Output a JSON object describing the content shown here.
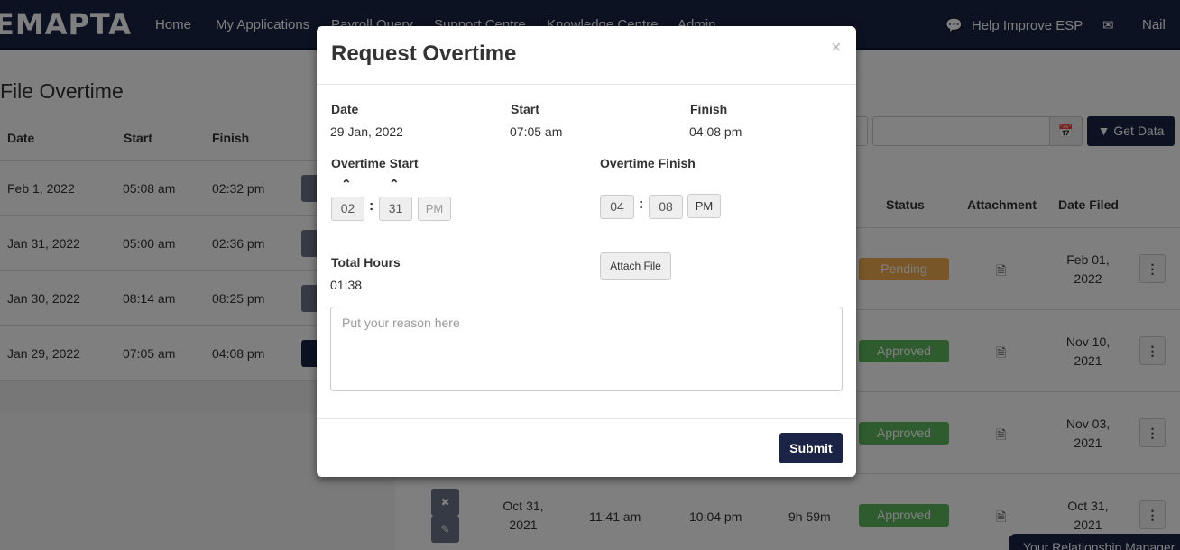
{
  "nav": {
    "logo": "EMAPTA",
    "items": [
      "Home",
      "My Applications",
      "Payroll Query",
      "Support Centre",
      "Knowledge Centre",
      "Admin"
    ],
    "help": "Help Improve ESP",
    "user": "Nail"
  },
  "page": {
    "title": "File Overtime",
    "left_headers": [
      "Date",
      "Start",
      "Finish"
    ],
    "left_rows": [
      {
        "date": "Feb 1, 2022",
        "start": "05:08 am",
        "finish": "02:32 pm"
      },
      {
        "date": "Jan 31, 2022",
        "start": "05:00 am",
        "finish": "02:36 pm"
      },
      {
        "date": "Jan 30, 2022",
        "start": "08:14 am",
        "finish": "08:25 pm"
      },
      {
        "date": "Jan 29, 2022",
        "start": "07:05 am",
        "finish": "04:08 pm"
      }
    ],
    "get_data_label": "Get Data",
    "right_headers": [
      "Status",
      "Attachment",
      "Date Filed"
    ],
    "right_rows": [
      {
        "status": "Pending",
        "date_filed": "Feb 01, 2022"
      },
      {
        "status": "Approved",
        "date_filed": "Nov 10, 2021"
      },
      {
        "status": "Approved",
        "date_filed": "Nov 03, 2021"
      },
      {
        "status": "Approved",
        "date_filed": "Oct 31, 2021",
        "date": "Oct 31, 2021",
        "start": "11:41 am",
        "finish": "10:04 pm",
        "total": "9h 59m"
      }
    ],
    "relationship_tab": "Your Relationship Manager",
    "colors": {
      "navy": "#1b2447",
      "pending": "#f0ad4e",
      "approved": "#5cb85c"
    }
  },
  "modal": {
    "title": "Request Overtime",
    "close": "×",
    "date_label": "Date",
    "date_value": "29 Jan, 2022",
    "start_label": "Start",
    "start_value": "07:05 am",
    "finish_label": "Finish",
    "finish_value": "04:08 pm",
    "ot_start_label": "Overtime Start",
    "ot_start": {
      "hour": "02",
      "minute": "31",
      "ampm": "PM"
    },
    "ot_finish_label": "Overtime Finish",
    "ot_finish": {
      "hour": "04",
      "minute": "08",
      "ampm": "PM"
    },
    "total_hours_label": "Total Hours",
    "total_hours_value": "01:38",
    "attach_label": "Attach File",
    "reason_placeholder": "Put your reason here",
    "submit_label": "Submit"
  }
}
